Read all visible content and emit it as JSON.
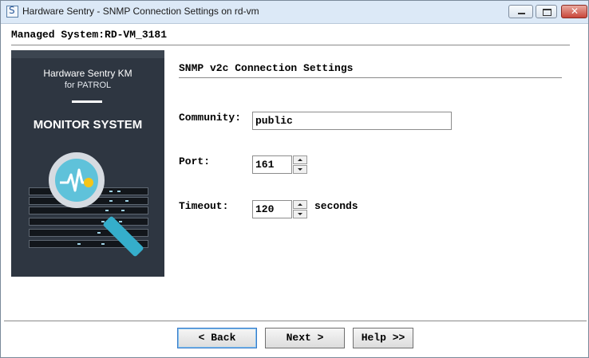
{
  "window": {
    "title": "Hardware Sentry - SNMP Connection Settings on rd-vm"
  },
  "header": {
    "managed_system": "Managed System:RD-VM_3181"
  },
  "banner": {
    "product_name": "Hardware Sentry KM",
    "product_sub": "for PATROL",
    "headline": "MONITOR SYSTEM"
  },
  "section": {
    "title": "SNMP v2c Connection Settings"
  },
  "form": {
    "community": {
      "label": "Community:",
      "value": "public"
    },
    "port": {
      "label": "Port:",
      "value": "161"
    },
    "timeout": {
      "label": "Timeout:",
      "value": "120",
      "unit": "seconds"
    }
  },
  "buttons": {
    "back": "< Back",
    "next": "Next >",
    "help": "Help >>"
  },
  "icons": [
    "app-icon",
    "minimize-icon",
    "maximize-icon",
    "close-icon",
    "magnifier-icon",
    "chevron-up-icon",
    "chevron-down-icon"
  ]
}
